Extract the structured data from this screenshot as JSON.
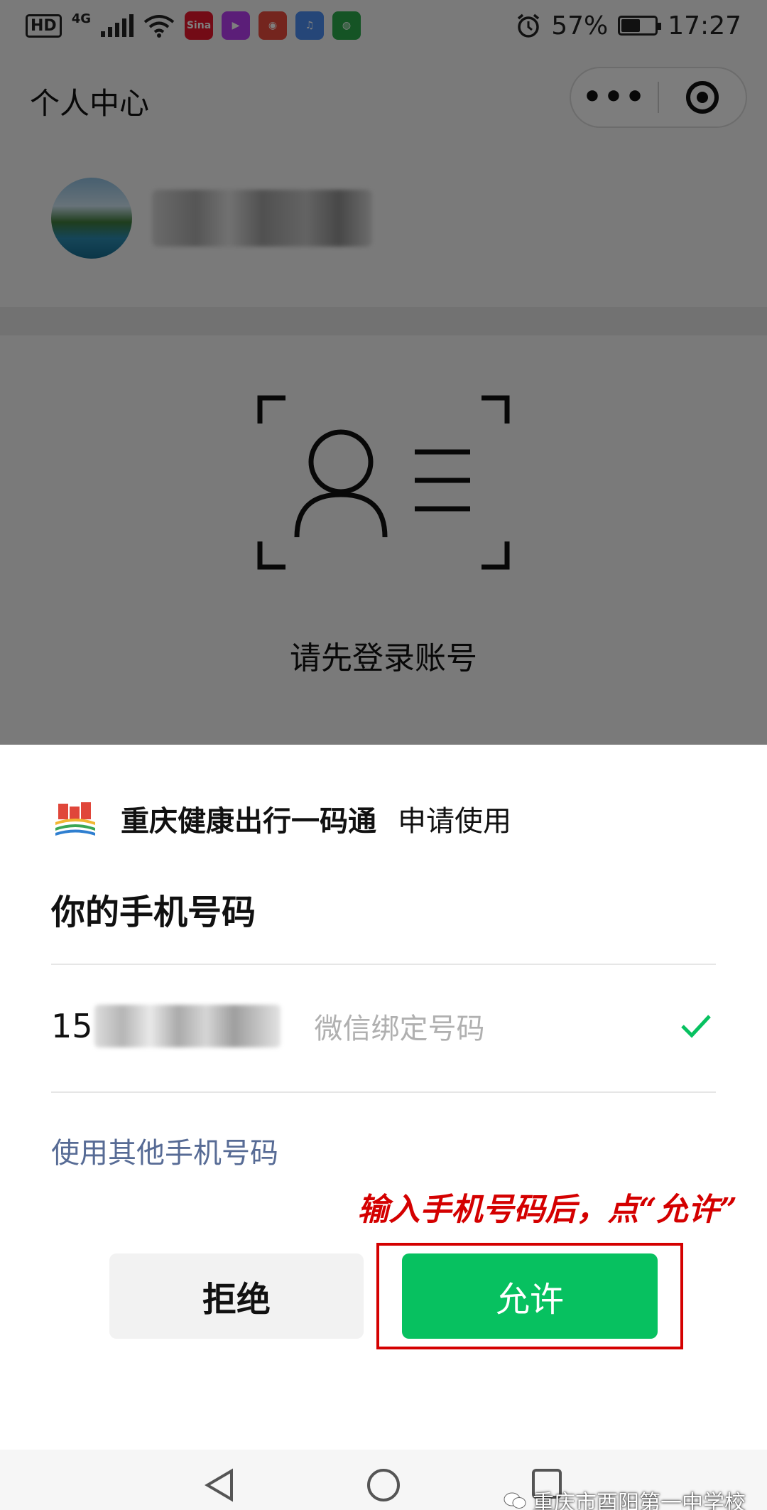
{
  "status_bar": {
    "hd": "HD",
    "network": "4G",
    "app_icons": [
      {
        "name": "sina-weibo-icon",
        "label": "Sina",
        "color": "#e6162d"
      },
      {
        "name": "video-app-icon",
        "label": "▶",
        "color": "#b63cf0"
      },
      {
        "name": "netease-app-icon",
        "label": "◉",
        "color": "#e84a3c"
      },
      {
        "name": "music-app-icon",
        "label": "♫",
        "color": "#4a8cf0"
      },
      {
        "name": "browser-app-icon",
        "label": "◍",
        "color": "#2aa84a"
      }
    ],
    "battery": "57%",
    "battery_level": 0.57,
    "time": "17:27"
  },
  "navbar": {
    "title": "个人中心",
    "more_glyph": "•••"
  },
  "user": {
    "avatar_icon": "landscape-avatar"
  },
  "login": {
    "icon": "id-card-scan-icon",
    "prompt": "请先登录账号"
  },
  "sheet": {
    "app_name": "重庆健康出行一码通",
    "request_text": "申请使用",
    "title": "你的手机号码",
    "phone_prefix": "15",
    "phone_tag": "微信绑定号码",
    "other_phone": "使用其他手机号码",
    "annotation": "输入手机号码后，点“允许”",
    "reject_label": "拒绝",
    "allow_label": "允许",
    "colors": {
      "allow": "#07c160",
      "annotation": "#d40000",
      "link": "#576b95"
    }
  },
  "watermark": "重庆市酉阳第一中学校"
}
